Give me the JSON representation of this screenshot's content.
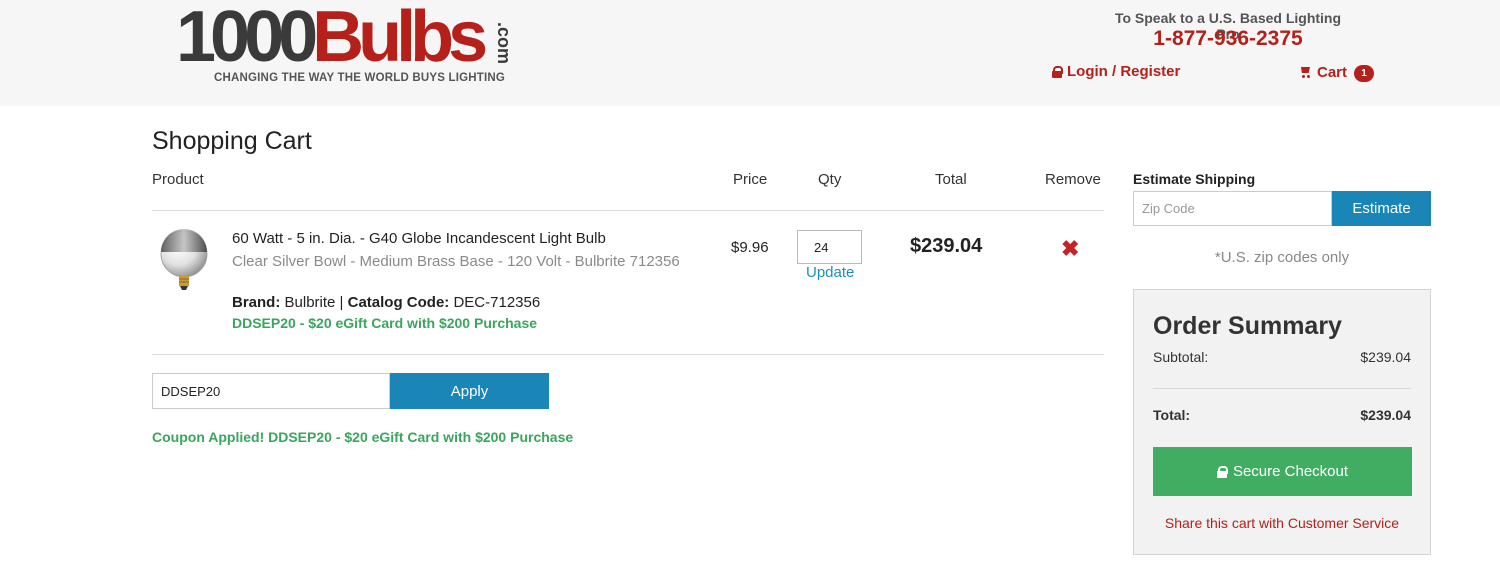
{
  "header": {
    "logo_number": "1000",
    "logo_word": "Bulbs",
    "logo_suffix": ".com",
    "tagline": "CHANGING THE WAY THE WORLD BUYS LIGHTING",
    "speak_text": "To Speak to a U.S. Based Lighting Pro",
    "phone": "1-877-936-2375",
    "login_label": "Login / Register",
    "cart_label": "Cart",
    "cart_count": "1"
  },
  "cart": {
    "title": "Shopping Cart",
    "columns": {
      "product": "Product",
      "price": "Price",
      "qty": "Qty",
      "total": "Total",
      "remove": "Remove"
    },
    "items": [
      {
        "name": "60 Watt - 5 in. Dia. - G40 Globe Incandescent Light Bulb",
        "description": "Clear Silver Bowl - Medium Brass Base - 120 Volt - Bulbrite 712356",
        "brand_label": "Brand:",
        "brand": "Bulbrite",
        "separator": "|",
        "catalog_label": "Catalog Code:",
        "catalog_code": "DEC-712356",
        "promo": "DDSEP20 - $20 eGift Card with $200 Purchase",
        "price": "$9.96",
        "qty": "24",
        "update_label": "Update",
        "total": "$239.04",
        "remove_symbol": "✖"
      }
    ],
    "coupon": {
      "value": "DDSEP20",
      "apply_label": "Apply",
      "message": "Coupon Applied! DDSEP20 - $20 eGift Card with $200 Purchase"
    }
  },
  "shipping": {
    "label": "Estimate Shipping",
    "zip_placeholder": "Zip Code",
    "estimate_label": "Estimate",
    "note": "*U.S. zip codes only"
  },
  "summary": {
    "title": "Order Summary",
    "subtotal_label": "Subtotal:",
    "subtotal": "$239.04",
    "total_label": "Total:",
    "total": "$239.04",
    "checkout_label": "Secure Checkout",
    "share_label": "Share this cart with Customer Service"
  },
  "icons": {
    "login": "lock-icon",
    "cart": "cart-icon",
    "checkout": "lock-icon",
    "remove": "close-icon"
  },
  "colors": {
    "brand_red": "#b5201b",
    "accent_blue": "#1a86b7",
    "success_green": "#41ad62",
    "promo_green": "#3aa55c"
  }
}
